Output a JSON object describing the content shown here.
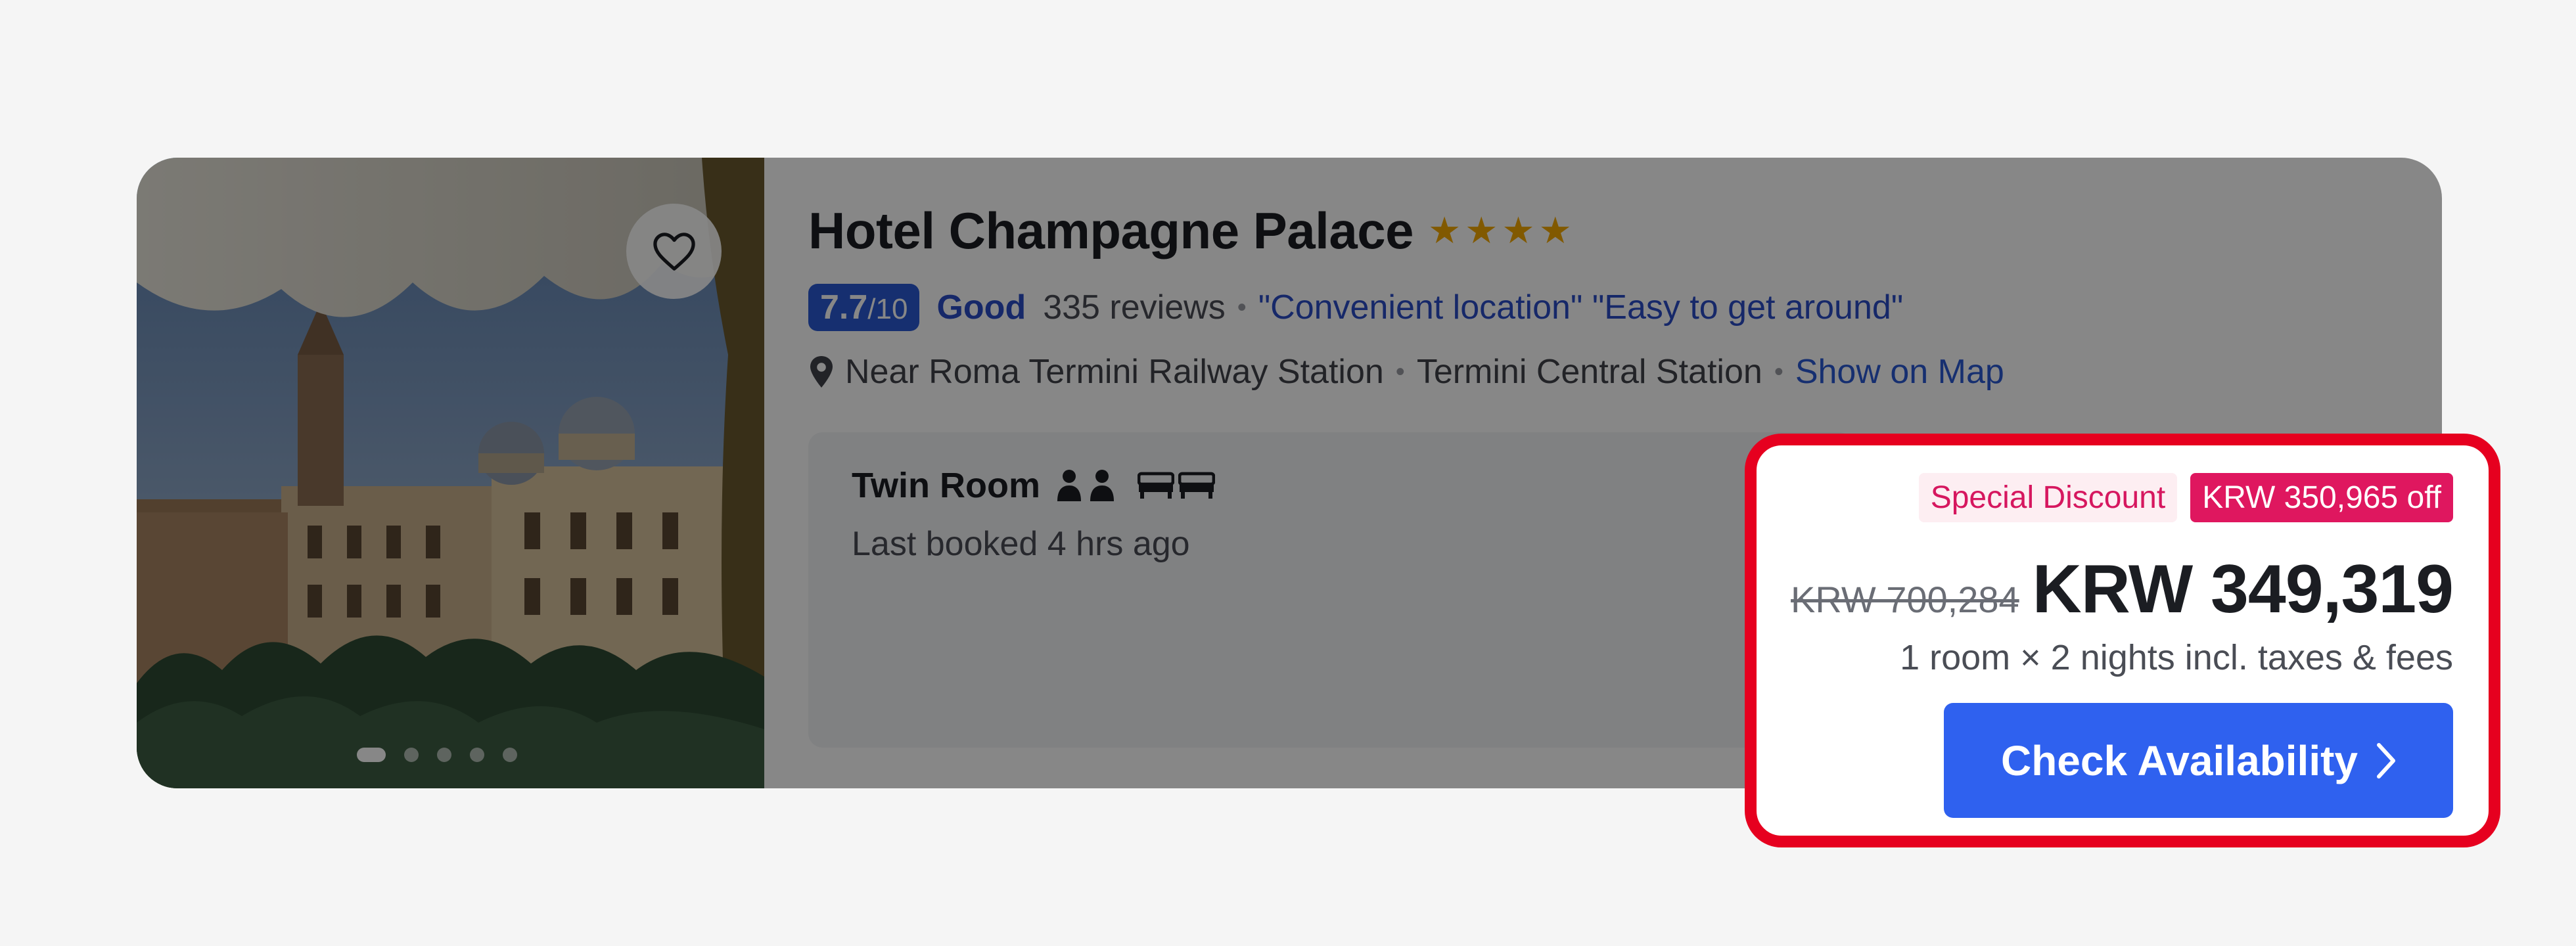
{
  "hotel": {
    "name": "Hotel Champagne Palace",
    "stars": 4,
    "photo_count": 5,
    "active_photo_index": 0
  },
  "rating": {
    "score": "7.7",
    "scale": "/10",
    "word": "Good",
    "reviews": "335 reviews",
    "highlights": "\"Convenient location\" \"Easy to get around\""
  },
  "location": {
    "near": "Near Roma Termini Railway Station",
    "station": "Termini Central Station",
    "map_link": "Show on Map"
  },
  "room": {
    "name": "Twin Room",
    "last_booked": "Last booked 4 hrs ago"
  },
  "price": {
    "special_label": "Special Discount",
    "discount_label": "KRW 350,965 off",
    "original": "KRW 700,284",
    "current": "KRW 349,319",
    "note": "1 room × 2 nights incl. taxes & fees",
    "cta_label": "Check Availability"
  },
  "colors": {
    "accent_blue": "#2f61ef",
    "discount_pink": "#df175f",
    "highlight_red": "#e6001f",
    "star_gold": "#f3a800"
  },
  "icons": {
    "favorite": "heart-icon",
    "location": "map-pin-icon",
    "guests": "person-icon",
    "beds": "bed-icon",
    "cta": "chevron-right-icon"
  }
}
